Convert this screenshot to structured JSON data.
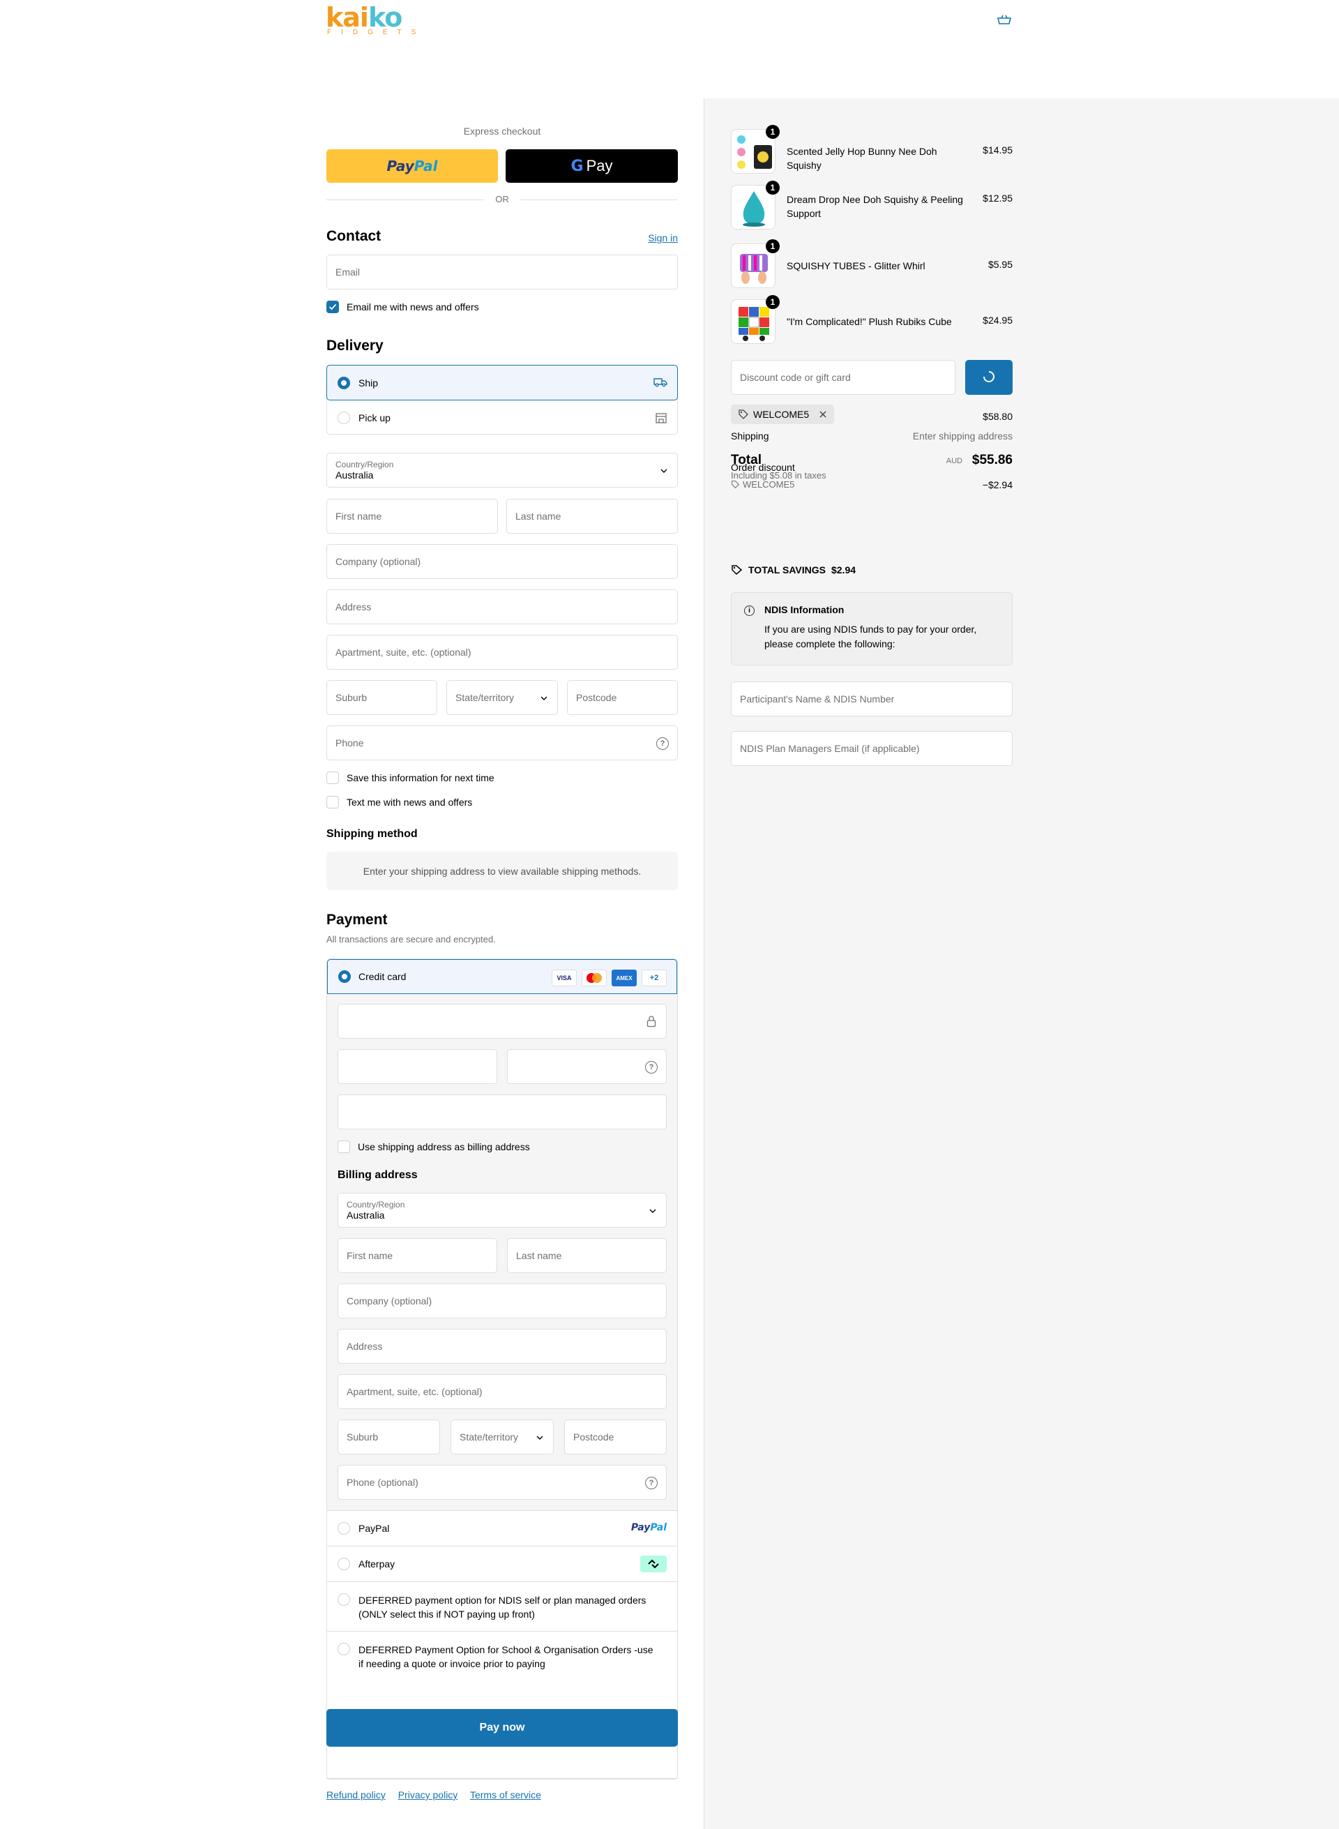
{
  "brand": {
    "logo_text_1": "ka",
    "logo_text_2": "i",
    "logo_text_3": "ko",
    "logo_sub": "FIDGETS"
  },
  "express": {
    "label": "Express checkout",
    "paypal_label_1": "Pay",
    "paypal_label_2": "Pal",
    "gpay_g": "G",
    "gpay_label": "Pay",
    "or_label": "OR"
  },
  "contact": {
    "heading": "Contact",
    "sign_in": "Sign in",
    "email_placeholder": "Email",
    "news_label": "Email me with news and offers",
    "news_checked": true
  },
  "delivery": {
    "heading": "Delivery",
    "ship_label": "Ship",
    "pickup_label": "Pick up",
    "country_label": "Country/Region",
    "country_value": "Australia",
    "first_name": "First name",
    "last_name": "Last name",
    "company": "Company (optional)",
    "address": "Address",
    "apartment": "Apartment, suite, etc. (optional)",
    "suburb": "Suburb",
    "state": "State/territory",
    "postcode": "Postcode",
    "phone": "Phone",
    "save_info": "Save this information for next time",
    "text_me": "Text me with news and offers"
  },
  "shipping_method": {
    "heading": "Shipping method",
    "message": "Enter your shipping address to view available shipping methods."
  },
  "payment": {
    "heading": "Payment",
    "subtitle": "All transactions are secure and encrypted.",
    "credit_card": "Credit card",
    "brands": [
      "VISA",
      "MC",
      "AMEX",
      "+2"
    ],
    "use_shipping": "Use shipping address as billing address",
    "billing_heading": "Billing address",
    "country_label": "Country/Region",
    "country_value": "Australia",
    "first_name": "First name",
    "last_name": "Last name",
    "company": "Company (optional)",
    "address": "Address",
    "apartment": "Apartment, suite, etc. (optional)",
    "suburb": "Suburb",
    "state": "State/territory",
    "postcode": "Postcode",
    "phone": "Phone (optional)",
    "paypal": "PayPal",
    "paypal_logo_1": "Pay",
    "paypal_logo_2": "Pal",
    "afterpay": "Afterpay",
    "deferred_ndis": "DEFERRED payment option for NDIS self or plan managed orders (ONLY select this if NOT paying up front)",
    "deferred_school": "DEFERRED Payment Option for School & Organisation Orders -use if needing a quote or invoice prior to paying",
    "pay_now": "Pay now"
  },
  "footer": {
    "links": [
      "Refund policy",
      "Privacy policy",
      "Terms of service"
    ]
  },
  "summary": {
    "items": [
      {
        "name": "Scented Jelly Hop Bunny Nee Doh Squishy",
        "price": "$14.95",
        "qty": "1"
      },
      {
        "name": "Dream Drop Nee Doh Squishy & Peeling Support",
        "price": "$12.95",
        "qty": "1"
      },
      {
        "name": "SQUISHY TUBES - Glitter Whirl",
        "price": "$5.95",
        "qty": "1"
      },
      {
        "name": "\"I'm Complicated!\" Plush Rubiks Cube",
        "price": "$24.95",
        "qty": "1"
      }
    ],
    "discount_placeholder": "Discount code or gift card",
    "applied_code": "WELCOME5",
    "subtotal_value": "$58.80",
    "shipping_label": "Shipping",
    "shipping_value": "Enter shipping address",
    "order_discount_label": "Order discount",
    "order_discount_code": "WELCOME5",
    "order_discount_value": "−$2.94",
    "total_label": "Total",
    "total_currency": "AUD",
    "total_value": "$55.86",
    "taxes_note": "Including $5.08 in taxes",
    "savings_label": "TOTAL SAVINGS",
    "savings_value": "$2.94",
    "ndis_title": "NDIS Information",
    "ndis_text": "If you are using NDIS funds to pay for your order, please complete the following:",
    "ndis_name_placeholder": "Participant's Name & NDIS Number",
    "ndis_email_placeholder": "NDIS Plan Managers Email (if applicable)"
  },
  "colors": {
    "accent": "#1773b0",
    "paypal_yellow": "#ffc439",
    "logo_orange": "#f39a1c",
    "logo_teal": "#4ec0d3"
  }
}
